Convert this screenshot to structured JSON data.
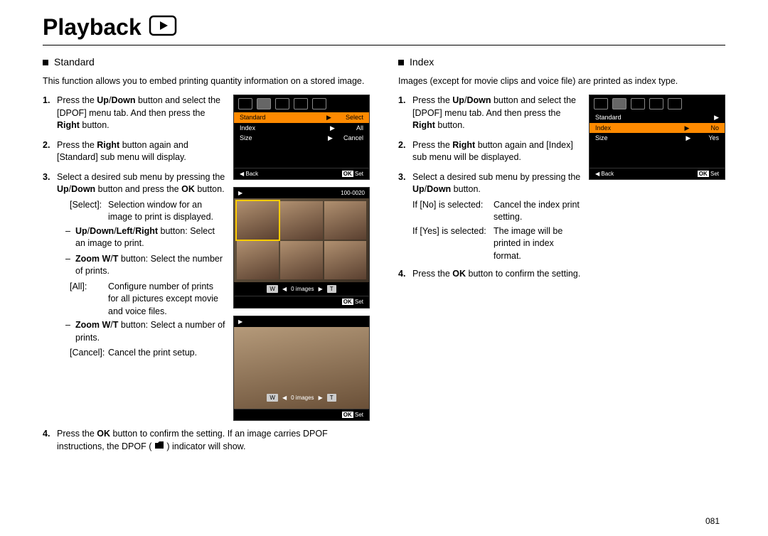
{
  "title": "Playback",
  "page_number": "081",
  "left": {
    "heading": "Standard",
    "intro": "This function allows you to embed printing quantity information on a stored image.",
    "steps": [
      {
        "n": "1.",
        "html": "Press the <b>Up</b>/<b>Down</b> button and select the [DPOF] menu tab. And then press the <b>Right</b> button."
      },
      {
        "n": "2.",
        "html": "Press the <b>Right</b> button again and [Standard] sub menu will display."
      },
      {
        "n": "3.",
        "html": "Select a desired sub menu by pressing the <b>Up</b>/<b>Down</b> button and press the <b>OK</b> button."
      }
    ],
    "step3_sub": [
      {
        "tag": "[Select]:",
        "text": "Selection window for an image to print is displayed."
      }
    ],
    "step3_dashes": [
      {
        "html": "<b>Up</b>/<b>Down</b>/<b>Left</b>/<b>Right</b> button: Select an image to print."
      },
      {
        "html": "<b>Zoom W</b>/<b>T</b> button: Select the number of prints."
      }
    ],
    "step3_all": {
      "tag": "[All]:",
      "text": "Configure number of prints for all pictures except movie and voice files."
    },
    "step3_all_dash": {
      "html": "<b>Zoom W</b>/<b>T</b> button:  Select a number of prints."
    },
    "step3_cancel": {
      "tag": "[Cancel]:",
      "text": "Cancel the print setup."
    },
    "step4": {
      "n": "4.",
      "html": "Press the <b>OK</b> button to confirm the setting. If an image carries DPOF instructions, the DPOF ( <span class='dpof-ico'><svg width='14' height='12'><path d='M1 11 L1 3 L5 3 L7 1 L13 1 L13 11 Z' fill='#000'/></svg></span> ) indicator will show."
    },
    "fig1": {
      "menu": [
        {
          "l": "Standard",
          "r": "Select",
          "sel": true
        },
        {
          "l": "Index",
          "r": "All"
        },
        {
          "l": "Size",
          "r": "Cancel"
        }
      ],
      "footer": {
        "back": "Back",
        "set": "Set",
        "ok": "OK"
      }
    },
    "fig2": {
      "counter": "100-0020",
      "wt": {
        "w": "W",
        "t": "T",
        "mid": "0 images"
      },
      "ok": "OK",
      "set": "Set"
    },
    "fig3": {
      "wt": {
        "w": "W",
        "t": "T",
        "mid": "0 images"
      },
      "ok": "OK",
      "set": "Set"
    }
  },
  "right": {
    "heading": "Index",
    "intro": "Images (except for movie clips and voice file) are printed as index type.",
    "steps": [
      {
        "n": "1.",
        "html": "Press the <b>Up</b>/<b>Down</b> button and select the [DPOF] menu tab. And then press the <b>Right</b> button."
      },
      {
        "n": "2.",
        "html": "Press the <b>Right</b> button again and [Index] sub menu will be displayed."
      },
      {
        "n": "3.",
        "html": "Select a desired sub menu by pressing the <b>Up</b>/<b>Down</b> button."
      }
    ],
    "step3_if": [
      {
        "tag": "If [No] is selected:",
        "text": "Cancel the index print setting."
      },
      {
        "tag": "If [Yes] is selected:",
        "text": "The image will be printed in index format."
      }
    ],
    "step4": {
      "n": "4.",
      "html": "Press the <b>OK</b> button to confirm the setting."
    },
    "fig1": {
      "menu": [
        {
          "l": "Standard",
          "r": "",
          "sel": false,
          "arrow": true
        },
        {
          "l": "Index",
          "r": "No",
          "sel": true
        },
        {
          "l": "Size",
          "r": "Yes"
        }
      ],
      "footer": {
        "back": "Back",
        "set": "Set",
        "ok": "OK"
      }
    }
  }
}
